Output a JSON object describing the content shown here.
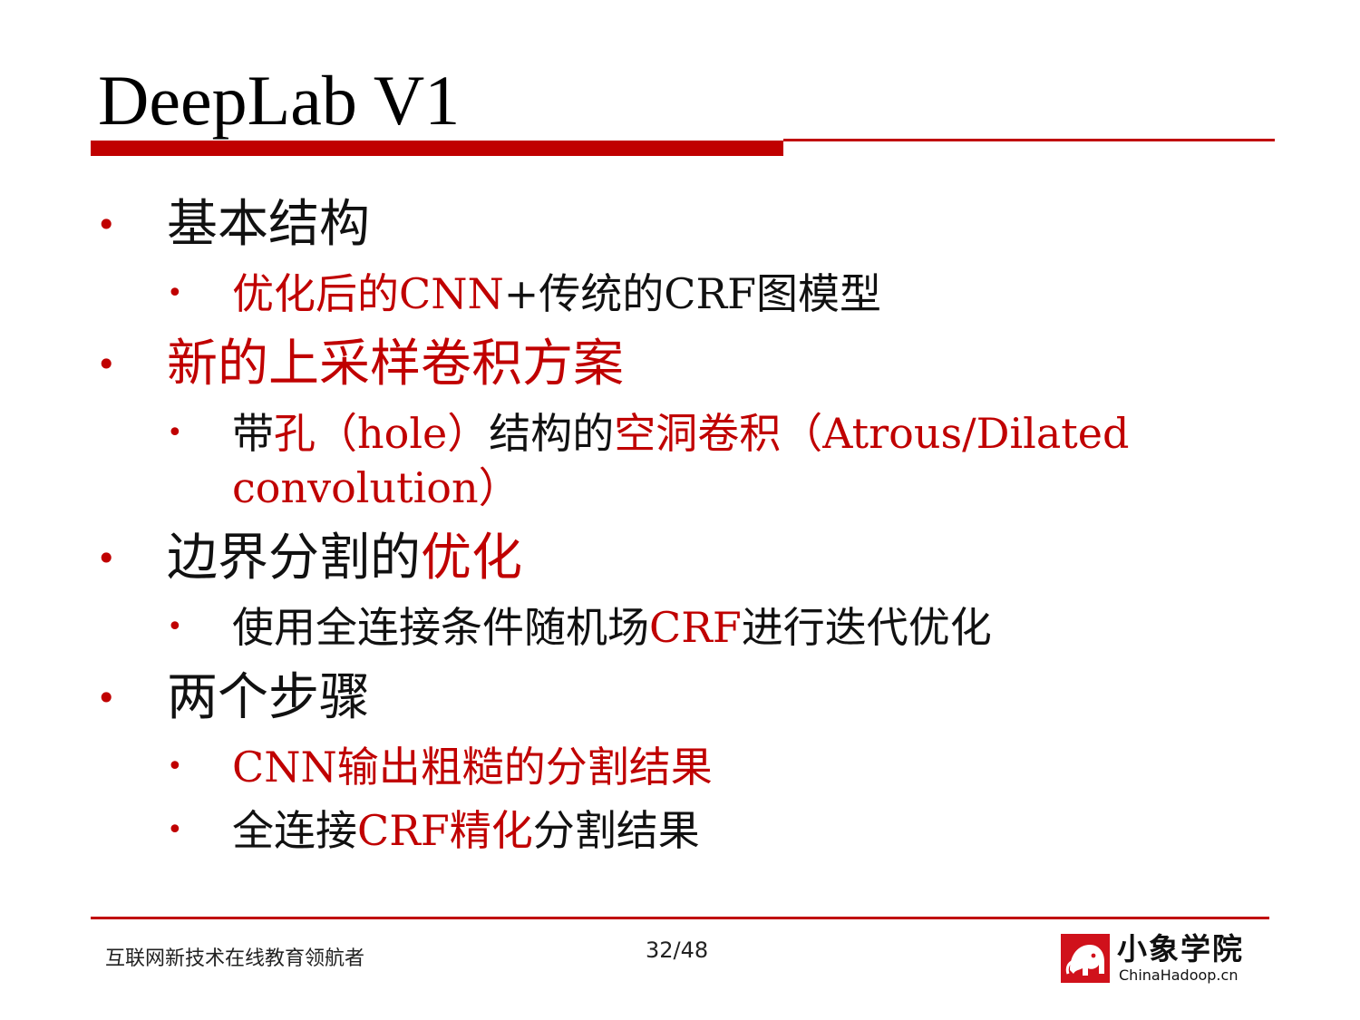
{
  "slide": {
    "title": "DeepLab V1",
    "items": [
      {
        "level": 1,
        "parts": [
          {
            "text": "基本结构",
            "tone": "black"
          }
        ]
      },
      {
        "level": 2,
        "parts": [
          {
            "text": "优化后的CNN",
            "tone": "red"
          },
          {
            "text": "+传统的CRF图模型",
            "tone": "black"
          }
        ]
      },
      {
        "level": 1,
        "parts": [
          {
            "text": "新的上采样卷积方案",
            "tone": "red"
          }
        ]
      },
      {
        "level": 2,
        "parts": [
          {
            "text": "带",
            "tone": "black"
          },
          {
            "text": "孔（hole）",
            "tone": "red"
          },
          {
            "text": "结构的",
            "tone": "black"
          },
          {
            "text": "空洞卷积（Atrous/Dilated",
            "tone": "red"
          }
        ]
      },
      {
        "level": 2,
        "continuation": true,
        "parts": [
          {
            "text": "convolution）",
            "tone": "red"
          }
        ]
      },
      {
        "level": 1,
        "parts": [
          {
            "text": "边界分割的",
            "tone": "black"
          },
          {
            "text": "优化",
            "tone": "red"
          }
        ]
      },
      {
        "level": 2,
        "parts": [
          {
            "text": "使用全连接条件随机场",
            "tone": "black"
          },
          {
            "text": "CRF",
            "tone": "red"
          },
          {
            "text": "进行迭代优化",
            "tone": "black"
          }
        ]
      },
      {
        "level": 1,
        "parts": [
          {
            "text": "两个步骤",
            "tone": "black"
          }
        ]
      },
      {
        "level": 2,
        "parts": [
          {
            "text": "CNN输出粗糙的分割结果",
            "tone": "red"
          }
        ]
      },
      {
        "level": 2,
        "parts": [
          {
            "text": "全连接",
            "tone": "black"
          },
          {
            "text": "CRF精化",
            "tone": "red"
          },
          {
            "text": "分割结果",
            "tone": "black"
          }
        ]
      }
    ],
    "bullet_glyph": "•"
  },
  "footer": {
    "tagline": "互联网新技术在线教育领航者",
    "page": "32/48",
    "logo_text": "小象学院",
    "logo_domain": "ChinaHadoop.cn"
  },
  "colors": {
    "accent": "#c00000",
    "text": "#111111",
    "background": "#ffffff"
  },
  "icons": {
    "logo_mark": "elephant-logo-icon"
  }
}
